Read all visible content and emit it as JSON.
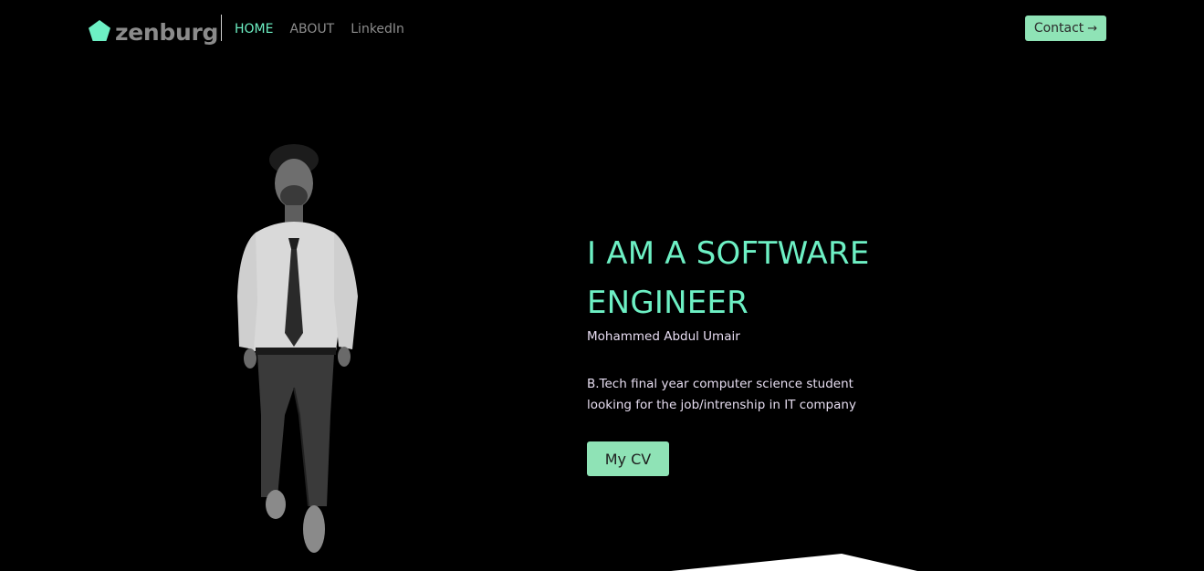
{
  "header": {
    "logo_text": "zenburg",
    "nav": {
      "home": "HOME",
      "about": "ABOUT",
      "linkedin": "LinkedIn"
    },
    "contact_label": "Contact",
    "contact_icon": "arrow-right-icon"
  },
  "hero": {
    "title": "I AM A SOFTWARE ENGINEER",
    "name": "Mohammed Abdul Umair",
    "description": "B.Tech final year computer science student looking for the job/intrenship in IT company",
    "cv_label": "My CV"
  },
  "colors": {
    "background": "#000000",
    "accent": "#6df0c4",
    "button": "#8fe3b6",
    "nav_inactive": "#8d8d8d",
    "logo_text": "#8b8b8b"
  }
}
